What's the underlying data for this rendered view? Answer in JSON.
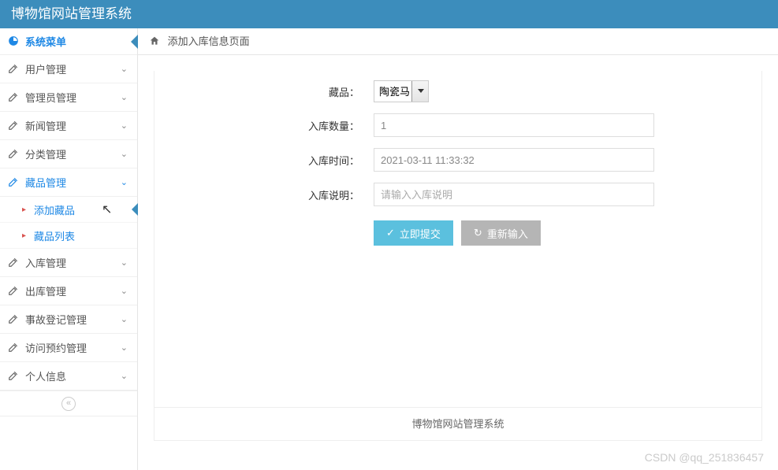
{
  "header": {
    "title": "博物馆网站管理系统"
  },
  "sidebar": {
    "menu_title": "系统菜单",
    "items": [
      {
        "label": "用户管理",
        "expanded": false
      },
      {
        "label": "管理员管理",
        "expanded": false
      },
      {
        "label": "新闻管理",
        "expanded": false
      },
      {
        "label": "分类管理",
        "expanded": false
      },
      {
        "label": "藏品管理",
        "expanded": true,
        "children": [
          {
            "label": "添加藏品",
            "active": true
          },
          {
            "label": "藏品列表",
            "active": false
          }
        ]
      },
      {
        "label": "入库管理",
        "expanded": false
      },
      {
        "label": "出库管理",
        "expanded": false
      },
      {
        "label": "事故登记管理",
        "expanded": false
      },
      {
        "label": "访问预约管理",
        "expanded": false
      },
      {
        "label": "个人信息",
        "expanded": false
      }
    ]
  },
  "breadcrumb": {
    "title": "添加入库信息页面"
  },
  "form": {
    "fields": {
      "collection": {
        "label": "藏品：",
        "value": "陶瓷马"
      },
      "quantity": {
        "label": "入库数量：",
        "value": "1"
      },
      "time": {
        "label": "入库时间：",
        "value": "2021-03-11 11:33:32"
      },
      "desc": {
        "label": "入库说明：",
        "placeholder": "请输入入库说明"
      }
    },
    "buttons": {
      "submit": "立即提交",
      "reset": "重新输入"
    }
  },
  "footer": {
    "text": "博物馆网站管理系统"
  },
  "watermark": "CSDN @qq_251836457"
}
